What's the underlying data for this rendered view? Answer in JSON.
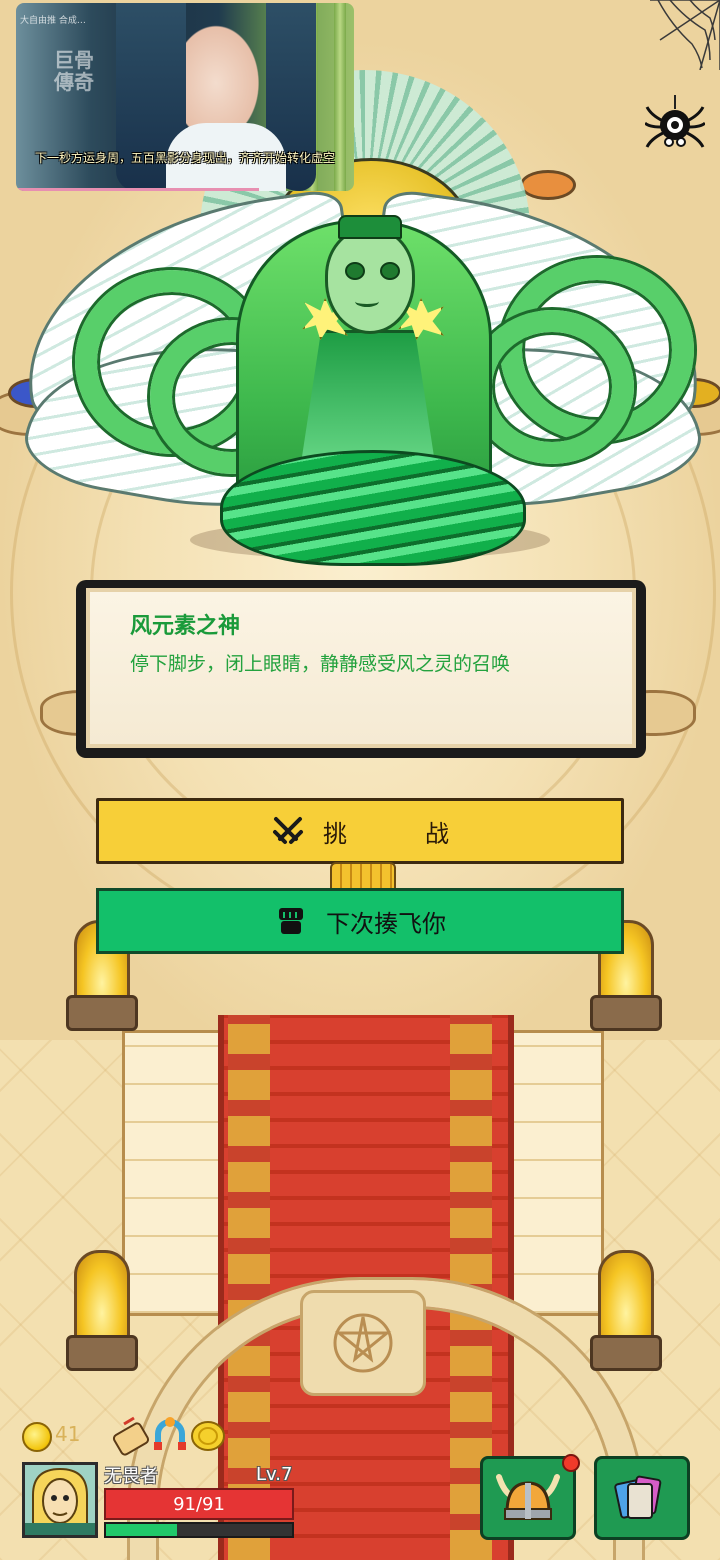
{
  "video_overlay": {
    "watermark": "大自由推 合成…",
    "logo_text": "巨骨 傳奇",
    "subtitle": "下一秒方运身周，五百黑影分身现出，齐齐开始转化虚空",
    "progress": 0.72
  },
  "boss_dialog": {
    "name": "风元素之神",
    "line": "停下脚步，闭上眼睛，静静感受风之灵的召唤"
  },
  "actions": {
    "challenge": {
      "label_1": "挑",
      "label_2": "战",
      "icon": "crossed-swords-icon"
    },
    "escape": {
      "label": "下次揍飞你",
      "icon": "fist-icon"
    }
  },
  "player": {
    "coins": "41",
    "name": "无畏者",
    "level": "Lv.7",
    "hp": "91/91",
    "xp_fraction": 0.38
  },
  "inventory_icons": [
    "scroll-icon",
    "magnet-icon",
    "gold-coin-icon"
  ],
  "hud_buttons": [
    {
      "name": "equipment-button",
      "icon": "viking-helmet-icon",
      "badge": true
    },
    {
      "name": "cards-button",
      "icon": "cards-icon",
      "badge": false
    }
  ],
  "colors": {
    "title_green": "#1a9a3a",
    "challenge_yellow": "#f7cf38",
    "escape_green": "#13c06a",
    "hp_red": "#e53434",
    "xp_green": "#21c86a"
  }
}
